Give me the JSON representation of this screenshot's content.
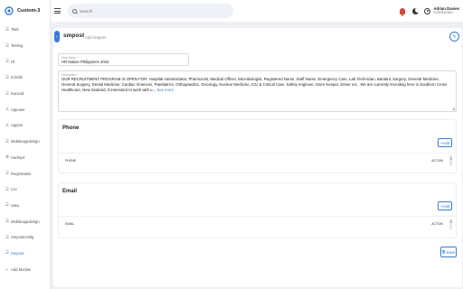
{
  "app": {
    "name": "Custom-3"
  },
  "sidebar": {
    "items": [
      {
        "label": "Task",
        "icon": "list-icon"
      },
      {
        "label": "Testing",
        "icon": "list-icon"
      },
      {
        "label": "Hf",
        "icon": "list-icon"
      },
      {
        "label": "Kcfcdb",
        "icon": "list-icon"
      },
      {
        "label": "Kanzad",
        "icon": "list-icon"
      },
      {
        "label": "Appuser",
        "icon": "user-icon"
      },
      {
        "label": "Appcto",
        "icon": "user-icon"
      },
      {
        "label": "Mobileappdesign",
        "icon": "list-icon"
      },
      {
        "label": "Hadiryer",
        "icon": "gear-icon"
      },
      {
        "label": "Registration",
        "icon": "list-icon"
      },
      {
        "label": "Ccc",
        "icon": "list-icon"
      },
      {
        "label": "Vasu",
        "icon": "list-icon"
      },
      {
        "label": "Mobileappdesign",
        "icon": "list-icon"
      },
      {
        "label": "Smpostconfig",
        "icon": "list-icon"
      },
      {
        "label": "Smpost",
        "icon": "list-icon",
        "active": true
      },
      {
        "label": "Add Module",
        "icon": "plus-icon"
      }
    ]
  },
  "header": {
    "search_placeholder": "Search",
    "user_name": "Adrian Davies",
    "user_role": "SUPERADMIN"
  },
  "breadcrumb": {
    "title": "smpost",
    "sub": "/ Add Smpost"
  },
  "form": {
    "name_label": "Task Name *",
    "name_value": "HR Nation Philippines 2024",
    "desc_label": "Description *",
    "desc_value": "OUR RECRUITMENT PROGRAM IS OPEN FOR: Hospital Administrator, Pharmacist, Medical Officer, Microbiologist, Registered Nurse, Staff Nurse, Emergency Care, Lab Technician, Bariatric Surgery, General Medicine, General Surgery, Dental Medicine, Cardiac Sciences, Paediatrics, Orthopaedics, Oncology, Nuclear Medicine, ICU & Critical Care, Safety engineer, Store Keeper, Driver etc.. We are currently recruiting here in Southern Cross Healthcare, New Zealand, if interested to work with u...",
    "desc_more": "See more"
  },
  "phone_section": {
    "title": "Phone",
    "add_label": "+Add",
    "col_name": "PHONE",
    "col_action": "ACTION"
  },
  "email_section": {
    "title": "Email",
    "add_label": "+Add",
    "col_name": "EMAIL",
    "col_action": "ACTION"
  },
  "save_label": "Save",
  "colors": {
    "accent": "#3a7bd5",
    "bell": "#d9453a"
  }
}
